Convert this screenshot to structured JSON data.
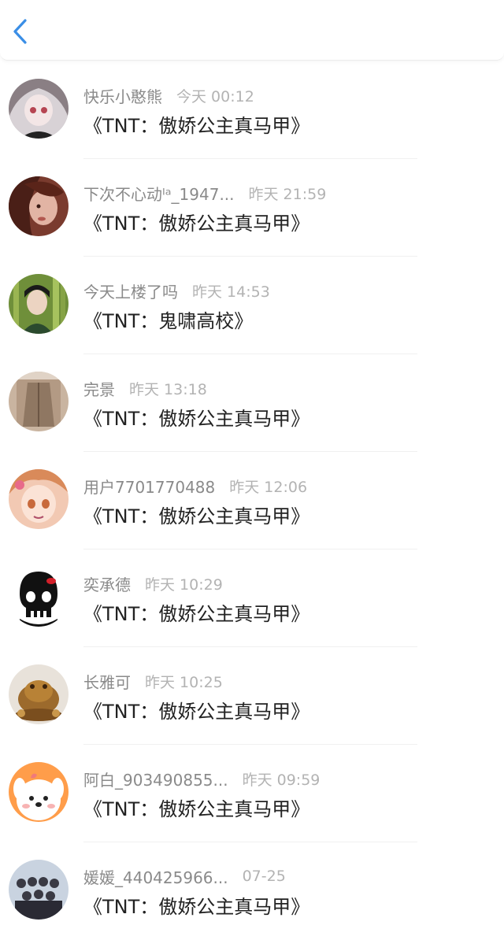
{
  "header": {
    "back_icon": "chevron-left-icon",
    "accent_color": "#3a8ee6"
  },
  "comments": [
    {
      "name": "快乐小憨熊",
      "time": "今天 00:12",
      "title": "《TNT：傲娇公主真马甲》",
      "avatar": "anime-girl-avatar"
    },
    {
      "name": "下次不心动ᴵᵃ_1947...",
      "time": "昨天 21:59",
      "title": "《TNT：傲娇公主真马甲》",
      "avatar": "girl-photo-avatar"
    },
    {
      "name": "今天上楼了吗",
      "time": "昨天 14:53",
      "title": "《TNT：鬼啸高校》",
      "avatar": "bamboo-photo-avatar"
    },
    {
      "name": "完景",
      "time": "昨天 13:18",
      "title": "《TNT：傲娇公主真马甲》",
      "avatar": "clothing-photo-avatar"
    },
    {
      "name": "用户7701770488",
      "time": "昨天 12:06",
      "title": "《TNT：傲娇公主真马甲》",
      "avatar": "anime-face-avatar"
    },
    {
      "name": "奕承德",
      "time": "昨天 10:29",
      "title": "《TNT：傲娇公主真马甲》",
      "avatar": "skull-avatar"
    },
    {
      "name": "长雅可",
      "time": "昨天 10:25",
      "title": "《TNT：傲娇公主真马甲》",
      "avatar": "golden-toad-avatar"
    },
    {
      "name": "阿白_903490855...",
      "time": "昨天 09:59",
      "title": "《TNT：傲娇公主真马甲》",
      "avatar": "cartoon-dog-avatar"
    },
    {
      "name": "媛媛_440425966...",
      "time": "07-25",
      "title": "《TNT：傲娇公主真马甲》",
      "avatar": "group-photo-avatar"
    }
  ]
}
